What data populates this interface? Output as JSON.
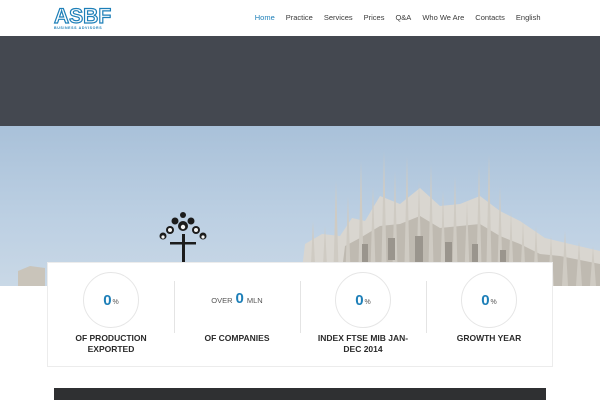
{
  "logo": {
    "text": "ASBF",
    "subtitle": "BUSINESS ADVISORS"
  },
  "nav": {
    "items": [
      {
        "label": "Home",
        "active": true
      },
      {
        "label": "Practice",
        "active": false
      },
      {
        "label": "Services",
        "active": false
      },
      {
        "label": "Prices",
        "active": false
      },
      {
        "label": "Q&A",
        "active": false
      },
      {
        "label": "Who We Are",
        "active": false
      },
      {
        "label": "Contacts",
        "active": false
      },
      {
        "label": "English",
        "active": false
      }
    ]
  },
  "stats": [
    {
      "value": "0",
      "unit": "%",
      "label": "OF PRODUCTION EXPORTED"
    },
    {
      "prefix": "OVER",
      "value": "0",
      "suffix": "MLN",
      "label": "OF COMPANIES"
    },
    {
      "value": "0",
      "unit": "%",
      "label": "INDEX FTSE MIB JAN-DEC 2014"
    },
    {
      "value": "0",
      "unit": "%",
      "label": "GROWTH YEAR"
    }
  ],
  "colors": {
    "accent": "#1d7fb8",
    "dark_band": "#444850",
    "bottom_bar": "#2f3032"
  }
}
